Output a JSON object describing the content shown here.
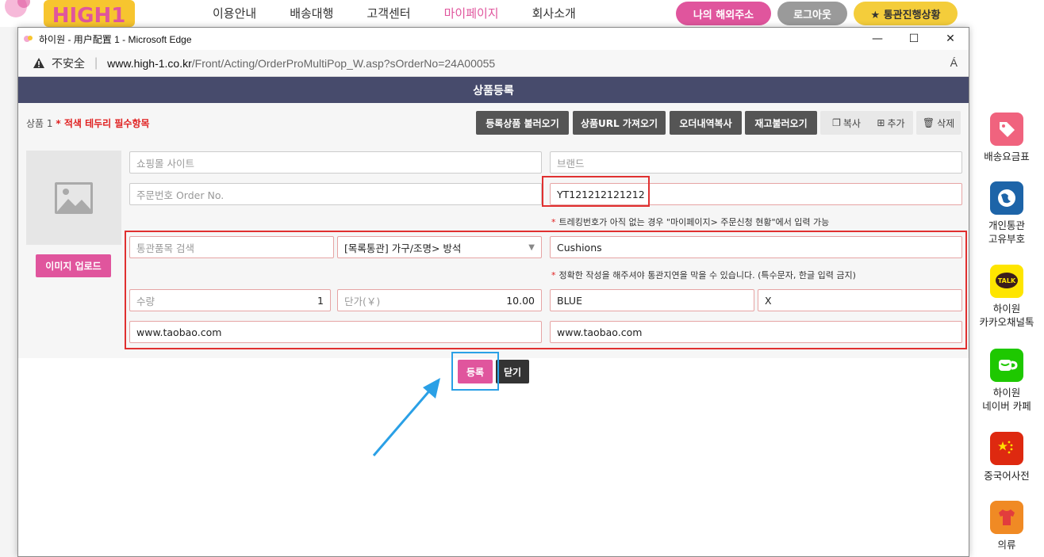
{
  "site": {
    "nav": [
      "이용안내",
      "배송대행",
      "고객센터",
      "마이페이지",
      "회사소개"
    ],
    "nav_active_index": 3,
    "buttons": {
      "overseas_address": "나의 해외주소",
      "logout": "로그아웃",
      "customs_status": "★ 통관진행상황"
    },
    "quick_menu": [
      {
        "label": "배송요금표",
        "icon": "price-tag-icon"
      },
      {
        "label": "개인통관\n고유부호",
        "icon": "globe-icon"
      },
      {
        "label": "하이원\n카카오채널톡",
        "icon": "kakao-talk-icon"
      },
      {
        "label": "하이원\n네이버 카페",
        "icon": "naver-cafe-icon"
      },
      {
        "label": "중국어사전",
        "icon": "china-flag-icon"
      },
      {
        "label": "의류",
        "icon": "clothing-icon"
      }
    ],
    "colors": {
      "brand_pink": "#e0559d",
      "header_navy": "#474b6c",
      "annotation_red": "#e03030",
      "annotation_blue": "#2aa0e6"
    }
  },
  "window": {
    "title": "하이원 - 用户配置 1 - Microsoft Edge",
    "insecure_label": "不安全",
    "url_domain": "www.high-1.co.kr",
    "url_path": "/Front/Acting/OrderProMultiPop_W.asp?sOrderNo=24A00055",
    "read_aloud": "Á"
  },
  "modal": {
    "title": "상품등록",
    "product_label": "상품 1",
    "required_note": "* 적색 테두리 필수항목",
    "toolbar": {
      "load_registered": "등록상품 불러오기",
      "import_url": "상품URL 가져오기",
      "copy_order": "오더내역복사",
      "load_stock": "재고불러오기",
      "copy": "복사",
      "add": "추가",
      "delete": "삭제"
    },
    "image_upload": "이미지 업로드",
    "fields": {
      "shop_site": {
        "placeholder": "쇼핑몰 사이트",
        "value": ""
      },
      "brand": {
        "placeholder": "브랜드",
        "value": ""
      },
      "order_no": {
        "placeholder": "주문번호 Order No.",
        "value": ""
      },
      "tracking_no": {
        "value": "YT121212121212"
      },
      "tracking_hint": "트레킹번호가 아직 없는 경우 \"마이페이지> 주문신청 현황\"에서 입력 가능",
      "customs_search": {
        "placeholder": "통관품목 검색"
      },
      "customs_category": {
        "value": "[목록통관] 가구/조명> 방석"
      },
      "product_name": {
        "value": "Cushions"
      },
      "product_hint": "정확한 작성을 해주셔야 통관지연을 막을 수 있습니다. (특수문자, 한글 입력 금지)",
      "quantity": {
        "label": "수량",
        "value": "1"
      },
      "unit_price": {
        "label": "단가(￥)",
        "value": "10.00"
      },
      "color": {
        "value": "BLUE"
      },
      "size": {
        "value": "X"
      },
      "product_url": {
        "value": "www.taobao.com"
      },
      "image_url": {
        "value": "www.taobao.com"
      }
    },
    "actions": {
      "register": "등록",
      "close": "닫기"
    }
  }
}
